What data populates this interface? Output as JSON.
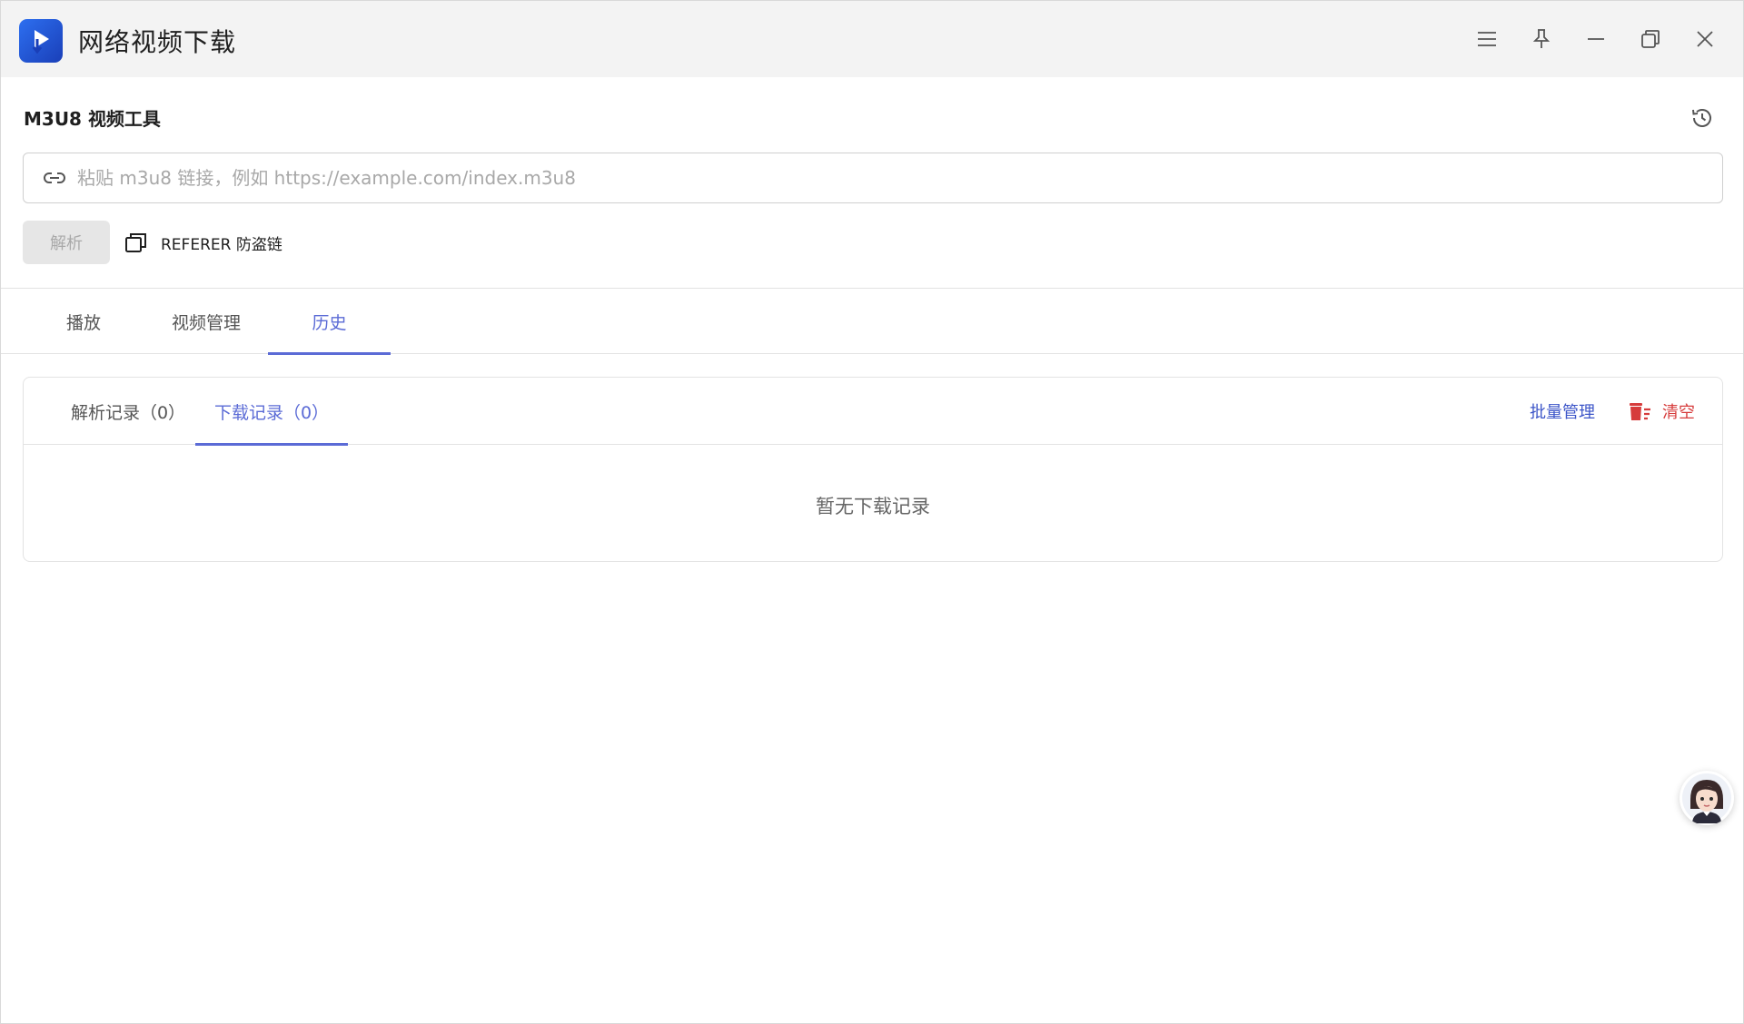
{
  "window": {
    "title": "网络视频下载",
    "controls": [
      "menu-icon",
      "pin-icon",
      "minimize-icon",
      "restore-icon",
      "close-icon"
    ]
  },
  "tool": {
    "title": "M3U8 视频工具",
    "url_input": {
      "value": "",
      "placeholder": "粘贴 m3u8 链接，例如 https://example.com/index.m3u8"
    },
    "parse_label": "解析",
    "referer_label": "REFERER 防盗链"
  },
  "main_tabs": [
    {
      "label": "播放",
      "active": false
    },
    {
      "label": "视频管理",
      "active": false
    },
    {
      "label": "历史",
      "active": true
    }
  ],
  "history": {
    "sub_tabs": [
      {
        "label": "解析记录（0）",
        "active": false
      },
      {
        "label": "下载记录（0）",
        "active": true
      }
    ],
    "batch_label": "批量管理",
    "clear_label": "清空",
    "empty_text": "暂无下载记录"
  },
  "colors": {
    "accent": "#5b6bd6",
    "link": "#3c55c8",
    "danger": "#d63c3c",
    "titlebar_bg": "#f3f3f3",
    "disabled_bg": "#e6e6e6"
  }
}
